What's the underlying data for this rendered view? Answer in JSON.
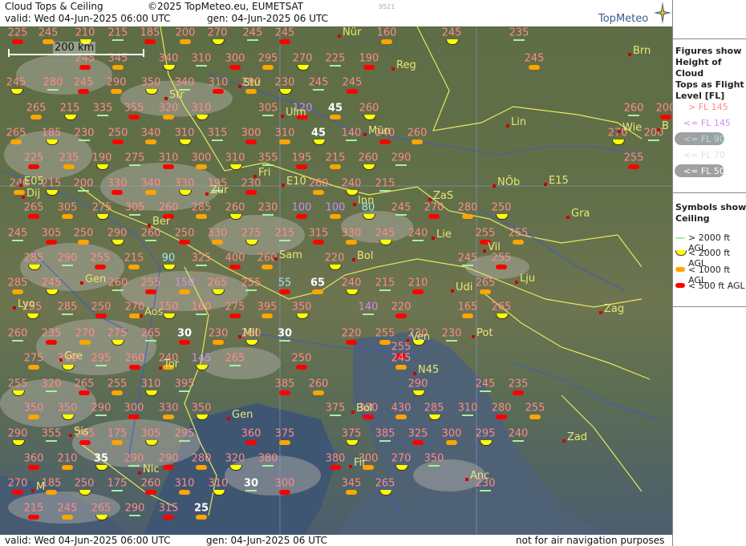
{
  "header": {
    "title": "Cloud Tops & Ceiling",
    "copyright": "©2025 TopMeteo.eu, EUMETSAT",
    "valid": "valid:  Wed   04-Jun-2025   06:00 UTC",
    "gen": "gen: 04-Jun-2025 06 UTC",
    "image_id": "9521",
    "logo": "TopMeteo"
  },
  "footer": {
    "valid": "valid:  Wed   04-Jun-2025   06:00 UTC",
    "gen": "gen:  04-Jun-2025 06 UTC",
    "disclaimer": "not for air navigation purposes"
  },
  "scale": {
    "label": "200 km"
  },
  "legend": {
    "tops_title": "Figures show Height of Cloud Tops as Flight Level  [FL]",
    "tops_title_lines": [
      "Figures show",
      "Height of Cloud",
      "Tops as Flight",
      "Level  [FL]"
    ],
    "tops": [
      {
        "label": "> FL 145",
        "color": "#ff8a8a"
      },
      {
        "label": "<= FL 145",
        "color": "#d08cf0"
      },
      {
        "label": "<= FL 90",
        "color": "#9ee6ee"
      },
      {
        "label": "<= FL 70",
        "color": "#e8e8e8"
      },
      {
        "label": "<= FL 50",
        "color": "#ffffff"
      }
    ],
    "ceiling_title_lines": [
      "Symbols show",
      "Ceiling"
    ],
    "ceiling": [
      {
        "label": "> 2000 ft AGL",
        "color": "#a8f0a0",
        "shape": "line"
      },
      {
        "label": "< 2000 ft AGL",
        "color": "#ffff00",
        "shape": "half"
      },
      {
        "label": "< 1000 ft AGL",
        "color": "#ffa500",
        "shape": "bar"
      },
      {
        "label": "< 500 ft AGL",
        "color": "#ff0000",
        "shape": "bar"
      }
    ]
  },
  "colors": {
    "high": "#ff8a8a",
    "mid": "#d08cf0",
    "low": "#9ee6ee",
    "lower": "#e8e8e8",
    "lowest": "#ffffff",
    "city": "#e8e870"
  },
  "cities": [
    {
      "name": "Nür"
    },
    {
      "name": "Reg"
    },
    {
      "name": "Brn"
    },
    {
      "name": "Stu"
    },
    {
      "name": "Str"
    },
    {
      "name": "Ulm"
    },
    {
      "name": "Mün"
    },
    {
      "name": "Lin"
    },
    {
      "name": "Wie"
    },
    {
      "name": "B"
    },
    {
      "name": "Fri"
    },
    {
      "name": "E10"
    },
    {
      "name": "E05"
    },
    {
      "name": "Dij"
    },
    {
      "name": "Zür"
    },
    {
      "name": "Inn"
    },
    {
      "name": "ZaS"
    },
    {
      "name": "NÖb"
    },
    {
      "name": "E15"
    },
    {
      "name": "Gra"
    },
    {
      "name": "Ber"
    },
    {
      "name": "Lie"
    },
    {
      "name": "Vil"
    },
    {
      "name": "Sam"
    },
    {
      "name": "Bol"
    },
    {
      "name": "Gen"
    },
    {
      "name": "Lju"
    },
    {
      "name": "Udi"
    },
    {
      "name": "Lyo"
    },
    {
      "name": "Aos"
    },
    {
      "name": "Mil"
    },
    {
      "name": "Zag"
    },
    {
      "name": "Ven"
    },
    {
      "name": "Pot"
    },
    {
      "name": "Gre"
    },
    {
      "name": "Tor"
    },
    {
      "name": "N45"
    },
    {
      "name": "Gen"
    },
    {
      "name": "Bol"
    },
    {
      "name": "Sis"
    },
    {
      "name": "Zad"
    },
    {
      "name": "Nic"
    },
    {
      "name": "Fir"
    },
    {
      "name": "Anc"
    },
    {
      "name": "M"
    }
  ],
  "labels": [
    {
      "v": "225",
      "c": "high"
    },
    {
      "v": "245",
      "c": "high"
    },
    {
      "v": "210",
      "c": "high"
    },
    {
      "v": "215",
      "c": "high"
    },
    {
      "v": "185",
      "c": "high"
    },
    {
      "v": "200",
      "c": "high"
    },
    {
      "v": "270",
      "c": "high"
    },
    {
      "v": "245",
      "c": "high"
    },
    {
      "v": "245",
      "c": "high"
    },
    {
      "v": "160",
      "c": "high"
    },
    {
      "v": "245",
      "c": "high"
    },
    {
      "v": "235",
      "c": "high"
    },
    {
      "v": "245",
      "c": "high"
    },
    {
      "v": "345",
      "c": "high"
    },
    {
      "v": "340",
      "c": "high"
    },
    {
      "v": "310",
      "c": "high"
    },
    {
      "v": "300",
      "c": "high"
    },
    {
      "v": "295",
      "c": "high"
    },
    {
      "v": "270",
      "c": "high"
    },
    {
      "v": "225",
      "c": "high"
    },
    {
      "v": "190",
      "c": "high"
    },
    {
      "v": "245",
      "c": "high"
    },
    {
      "v": "245",
      "c": "high"
    },
    {
      "v": "280",
      "c": "high"
    },
    {
      "v": "245",
      "c": "high"
    },
    {
      "v": "290",
      "c": "high"
    },
    {
      "v": "350",
      "c": "high"
    },
    {
      "v": "340",
      "c": "high"
    },
    {
      "v": "310",
      "c": "high"
    },
    {
      "v": "290",
      "c": "high"
    },
    {
      "v": "230",
      "c": "high"
    },
    {
      "v": "245",
      "c": "high"
    },
    {
      "v": "245",
      "c": "high"
    },
    {
      "v": "265",
      "c": "high"
    },
    {
      "v": "215",
      "c": "high"
    },
    {
      "v": "335",
      "c": "high"
    },
    {
      "v": "355",
      "c": "high"
    },
    {
      "v": "320",
      "c": "high"
    },
    {
      "v": "310",
      "c": "high"
    },
    {
      "v": "305",
      "c": "high"
    },
    {
      "v": "120",
      "c": "mid"
    },
    {
      "v": "45",
      "c": "lowest"
    },
    {
      "v": "260",
      "c": "high"
    },
    {
      "v": "260",
      "c": "high"
    },
    {
      "v": "200",
      "c": "high"
    },
    {
      "v": "265",
      "c": "high"
    },
    {
      "v": "185",
      "c": "high"
    },
    {
      "v": "230",
      "c": "high"
    },
    {
      "v": "250",
      "c": "high"
    },
    {
      "v": "340",
      "c": "high"
    },
    {
      "v": "310",
      "c": "high"
    },
    {
      "v": "315",
      "c": "high"
    },
    {
      "v": "300",
      "c": "high"
    },
    {
      "v": "310",
      "c": "high"
    },
    {
      "v": "45",
      "c": "lowest"
    },
    {
      "v": "140",
      "c": "high"
    },
    {
      "v": "240",
      "c": "high"
    },
    {
      "v": "260",
      "c": "high"
    },
    {
      "v": "270",
      "c": "high"
    },
    {
      "v": "200",
      "c": "high"
    },
    {
      "v": "225",
      "c": "high"
    },
    {
      "v": "235",
      "c": "high"
    },
    {
      "v": "190",
      "c": "high"
    },
    {
      "v": "275",
      "c": "high"
    },
    {
      "v": "310",
      "c": "high"
    },
    {
      "v": "300",
      "c": "high"
    },
    {
      "v": "310",
      "c": "high"
    },
    {
      "v": "355",
      "c": "high"
    },
    {
      "v": "195",
      "c": "high"
    },
    {
      "v": "215",
      "c": "high"
    },
    {
      "v": "260",
      "c": "high"
    },
    {
      "v": "290",
      "c": "high"
    },
    {
      "v": "255",
      "c": "high"
    },
    {
      "v": "240",
      "c": "high"
    },
    {
      "v": "215",
      "c": "high"
    },
    {
      "v": "200",
      "c": "high"
    },
    {
      "v": "330",
      "c": "high"
    },
    {
      "v": "340",
      "c": "high"
    },
    {
      "v": "330",
      "c": "high"
    },
    {
      "v": "195",
      "c": "high"
    },
    {
      "v": "230",
      "c": "high"
    },
    {
      "v": "260",
      "c": "high"
    },
    {
      "v": "240",
      "c": "high"
    },
    {
      "v": "215",
      "c": "high"
    },
    {
      "v": "265",
      "c": "high"
    },
    {
      "v": "305",
      "c": "high"
    },
    {
      "v": "275",
      "c": "high"
    },
    {
      "v": "305",
      "c": "high"
    },
    {
      "v": "260",
      "c": "high"
    },
    {
      "v": "285",
      "c": "high"
    },
    {
      "v": "260",
      "c": "high"
    },
    {
      "v": "230",
      "c": "high"
    },
    {
      "v": "100",
      "c": "mid"
    },
    {
      "v": "100",
      "c": "mid"
    },
    {
      "v": "80",
      "c": "low"
    },
    {
      "v": "245",
      "c": "high"
    },
    {
      "v": "270",
      "c": "high"
    },
    {
      "v": "280",
      "c": "high"
    },
    {
      "v": "250",
      "c": "high"
    },
    {
      "v": "245",
      "c": "high"
    },
    {
      "v": "305",
      "c": "high"
    },
    {
      "v": "250",
      "c": "high"
    },
    {
      "v": "290",
      "c": "high"
    },
    {
      "v": "260",
      "c": "high"
    },
    {
      "v": "250",
      "c": "high"
    },
    {
      "v": "330",
      "c": "high"
    },
    {
      "v": "275",
      "c": "high"
    },
    {
      "v": "215",
      "c": "high"
    },
    {
      "v": "315",
      "c": "high"
    },
    {
      "v": "330",
      "c": "high"
    },
    {
      "v": "245",
      "c": "high"
    },
    {
      "v": "240",
      "c": "high"
    },
    {
      "v": "255",
      "c": "high"
    },
    {
      "v": "255",
      "c": "high"
    },
    {
      "v": "285",
      "c": "high"
    },
    {
      "v": "290",
      "c": "high"
    },
    {
      "v": "255",
      "c": "high"
    },
    {
      "v": "215",
      "c": "high"
    },
    {
      "v": "90",
      "c": "low"
    },
    {
      "v": "325",
      "c": "high"
    },
    {
      "v": "400",
      "c": "high"
    },
    {
      "v": "260",
      "c": "high"
    },
    {
      "v": "220",
      "c": "high"
    },
    {
      "v": "245",
      "c": "high"
    },
    {
      "v": "255",
      "c": "high"
    },
    {
      "v": "285",
      "c": "high"
    },
    {
      "v": "245",
      "c": "high"
    },
    {
      "v": "260",
      "c": "high"
    },
    {
      "v": "255",
      "c": "high"
    },
    {
      "v": "150",
      "c": "mid"
    },
    {
      "v": "265",
      "c": "high"
    },
    {
      "v": "255",
      "c": "high"
    },
    {
      "v": "55",
      "c": "low"
    },
    {
      "v": "65",
      "c": "lowest"
    },
    {
      "v": "240",
      "c": "high"
    },
    {
      "v": "215",
      "c": "high"
    },
    {
      "v": "210",
      "c": "high"
    },
    {
      "v": "265",
      "c": "high"
    },
    {
      "v": "255",
      "c": "high"
    },
    {
      "v": "285",
      "c": "high"
    },
    {
      "v": "250",
      "c": "high"
    },
    {
      "v": "270",
      "c": "high"
    },
    {
      "v": "150",
      "c": "high"
    },
    {
      "v": "160",
      "c": "high"
    },
    {
      "v": "275",
      "c": "high"
    },
    {
      "v": "395",
      "c": "high"
    },
    {
      "v": "350",
      "c": "high"
    },
    {
      "v": "140",
      "c": "mid"
    },
    {
      "v": "220",
      "c": "high"
    },
    {
      "v": "165",
      "c": "high"
    },
    {
      "v": "265",
      "c": "high"
    },
    {
      "v": "260",
      "c": "high"
    },
    {
      "v": "235",
      "c": "high"
    },
    {
      "v": "270",
      "c": "high"
    },
    {
      "v": "275",
      "c": "high"
    },
    {
      "v": "265",
      "c": "high"
    },
    {
      "v": "30",
      "c": "lowest"
    },
    {
      "v": "230",
      "c": "high"
    },
    {
      "v": "280",
      "c": "high"
    },
    {
      "v": "30",
      "c": "lowest"
    },
    {
      "v": "220",
      "c": "high"
    },
    {
      "v": "255",
      "c": "high"
    },
    {
      "v": "230",
      "c": "high"
    },
    {
      "v": "230",
      "c": "high"
    },
    {
      "v": "255",
      "c": "high"
    },
    {
      "v": "275",
      "c": "high"
    },
    {
      "v": "310",
      "c": "high"
    },
    {
      "v": "295",
      "c": "high"
    },
    {
      "v": "260",
      "c": "high"
    },
    {
      "v": "240",
      "c": "high"
    },
    {
      "v": "145",
      "c": "mid"
    },
    {
      "v": "265",
      "c": "high"
    },
    {
      "v": "250",
      "c": "high"
    },
    {
      "v": "245",
      "c": "high"
    },
    {
      "v": "255",
      "c": "high"
    },
    {
      "v": "320",
      "c": "high"
    },
    {
      "v": "265",
      "c": "high"
    },
    {
      "v": "255",
      "c": "high"
    },
    {
      "v": "310",
      "c": "high"
    },
    {
      "v": "395",
      "c": "high"
    },
    {
      "v": "385",
      "c": "high"
    },
    {
      "v": "260",
      "c": "high"
    },
    {
      "v": "290",
      "c": "high"
    },
    {
      "v": "245",
      "c": "high"
    },
    {
      "v": "235",
      "c": "high"
    },
    {
      "v": "350",
      "c": "high"
    },
    {
      "v": "350",
      "c": "high"
    },
    {
      "v": "290",
      "c": "high"
    },
    {
      "v": "300",
      "c": "high"
    },
    {
      "v": "330",
      "c": "high"
    },
    {
      "v": "350",
      "c": "high"
    },
    {
      "v": "375",
      "c": "high"
    },
    {
      "v": "380",
      "c": "high"
    },
    {
      "v": "430",
      "c": "high"
    },
    {
      "v": "285",
      "c": "high"
    },
    {
      "v": "310",
      "c": "high"
    },
    {
      "v": "280",
      "c": "high"
    },
    {
      "v": "255",
      "c": "high"
    },
    {
      "v": "290",
      "c": "high"
    },
    {
      "v": "355",
      "c": "high"
    },
    {
      "v": "265",
      "c": "high"
    },
    {
      "v": "175",
      "c": "high"
    },
    {
      "v": "305",
      "c": "high"
    },
    {
      "v": "295",
      "c": "high"
    },
    {
      "v": "360",
      "c": "high"
    },
    {
      "v": "375",
      "c": "high"
    },
    {
      "v": "375",
      "c": "high"
    },
    {
      "v": "385",
      "c": "high"
    },
    {
      "v": "325",
      "c": "high"
    },
    {
      "v": "300",
      "c": "high"
    },
    {
      "v": "295",
      "c": "high"
    },
    {
      "v": "240",
      "c": "high"
    },
    {
      "v": "360",
      "c": "high"
    },
    {
      "v": "210",
      "c": "high"
    },
    {
      "v": "35",
      "c": "lowest"
    },
    {
      "v": "290",
      "c": "high"
    },
    {
      "v": "290",
      "c": "high"
    },
    {
      "v": "280",
      "c": "high"
    },
    {
      "v": "320",
      "c": "high"
    },
    {
      "v": "380",
      "c": "high"
    },
    {
      "v": "380",
      "c": "high"
    },
    {
      "v": "300",
      "c": "high"
    },
    {
      "v": "270",
      "c": "high"
    },
    {
      "v": "350",
      "c": "high"
    },
    {
      "v": "270",
      "c": "high"
    },
    {
      "v": "185",
      "c": "high"
    },
    {
      "v": "250",
      "c": "high"
    },
    {
      "v": "175",
      "c": "high"
    },
    {
      "v": "260",
      "c": "high"
    },
    {
      "v": "310",
      "c": "high"
    },
    {
      "v": "310",
      "c": "high"
    },
    {
      "v": "30",
      "c": "lowest"
    },
    {
      "v": "300",
      "c": "high"
    },
    {
      "v": "345",
      "c": "high"
    },
    {
      "v": "265",
      "c": "high"
    },
    {
      "v": "230",
      "c": "high"
    },
    {
      "v": "215",
      "c": "high"
    },
    {
      "v": "245",
      "c": "high"
    },
    {
      "v": "265",
      "c": "high"
    },
    {
      "v": "290",
      "c": "high"
    },
    {
      "v": "315",
      "c": "high"
    },
    {
      "v": "25",
      "c": "lowest"
    }
  ]
}
